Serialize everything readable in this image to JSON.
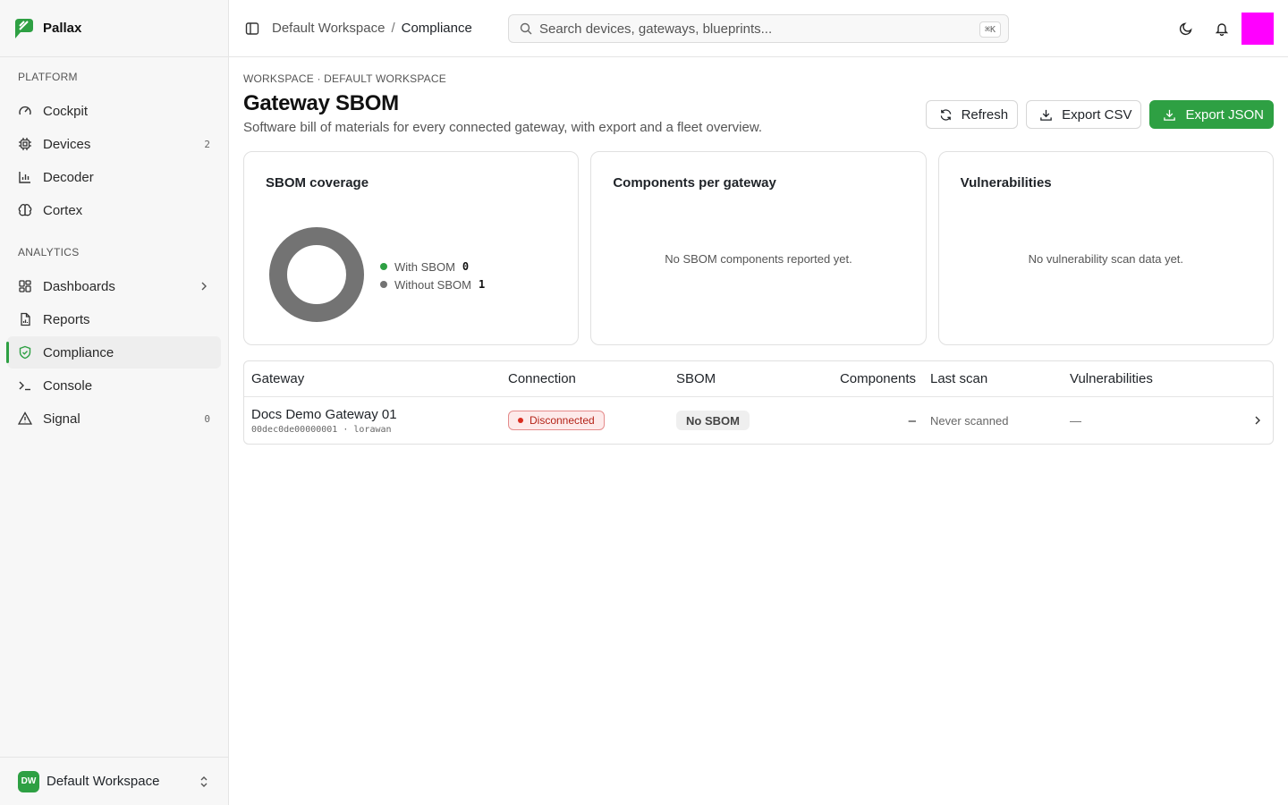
{
  "app": {
    "name": "Pallax"
  },
  "sidebar": {
    "sections": [
      {
        "label": "PLATFORM"
      },
      {
        "label": "ANALYTICS"
      }
    ],
    "items": [
      {
        "label": "Cockpit",
        "icon": "gauge-icon"
      },
      {
        "label": "Devices",
        "icon": "chip-icon",
        "count": "2"
      },
      {
        "label": "Decoder",
        "icon": "bar-chart-icon"
      },
      {
        "label": "Cortex",
        "icon": "brain-icon"
      },
      {
        "label": "Dashboards",
        "icon": "dashboard-icon"
      },
      {
        "label": "Reports",
        "icon": "report-icon"
      },
      {
        "label": "Compliance",
        "icon": "shield-check-icon",
        "active": true
      },
      {
        "label": "Console",
        "icon": "terminal-icon"
      },
      {
        "label": "Signal",
        "icon": "alert-icon",
        "count": "0"
      }
    ],
    "workspace": {
      "initials": "DW",
      "name": "Default Workspace"
    }
  },
  "topbar": {
    "breadcrumb": {
      "parent": "Default Workspace",
      "separator": "/",
      "current": "Compliance"
    },
    "search": {
      "placeholder": "Search devices, gateways, blueprints...",
      "shortcut": "⌘K"
    }
  },
  "page": {
    "eyebrow": "WORKSPACE · DEFAULT WORKSPACE",
    "title": "Gateway SBOM",
    "subtitle": "Software bill of materials for every connected gateway, with export and a fleet overview.",
    "actions": {
      "refresh": "Refresh",
      "export_csv": "Export CSV",
      "export_json": "Export JSON"
    }
  },
  "cards": {
    "coverage": {
      "title": "SBOM coverage",
      "legend": [
        {
          "label": "With SBOM",
          "value": "0",
          "color": "#2ea043"
        },
        {
          "label": "Without SBOM",
          "value": "1",
          "color": "#737373"
        }
      ]
    },
    "components": {
      "title": "Components per gateway",
      "empty": "No SBOM components reported yet."
    },
    "vulnerabilities": {
      "title": "Vulnerabilities",
      "empty": "No vulnerability scan data yet."
    }
  },
  "chart_data": {
    "type": "pie",
    "categories": [
      "With SBOM",
      "Without SBOM"
    ],
    "values": [
      0,
      1
    ],
    "colors": [
      "#2ea043",
      "#737373"
    ],
    "title": "SBOM coverage"
  },
  "table": {
    "columns": [
      "Gateway",
      "Connection",
      "SBOM",
      "Components",
      "Last scan",
      "Vulnerabilities"
    ],
    "rows": [
      {
        "name": "Docs Demo Gateway 01",
        "meta": "00dec0de00000001 · lorawan",
        "connection": "Disconnected",
        "sbom": "No SBOM",
        "components": "–",
        "last_scan": "Never scanned",
        "vulnerabilities": "—"
      }
    ]
  },
  "colors": {
    "accent": "#2ea043",
    "danger": "#d92d20",
    "avatar": "#ff00ff"
  }
}
